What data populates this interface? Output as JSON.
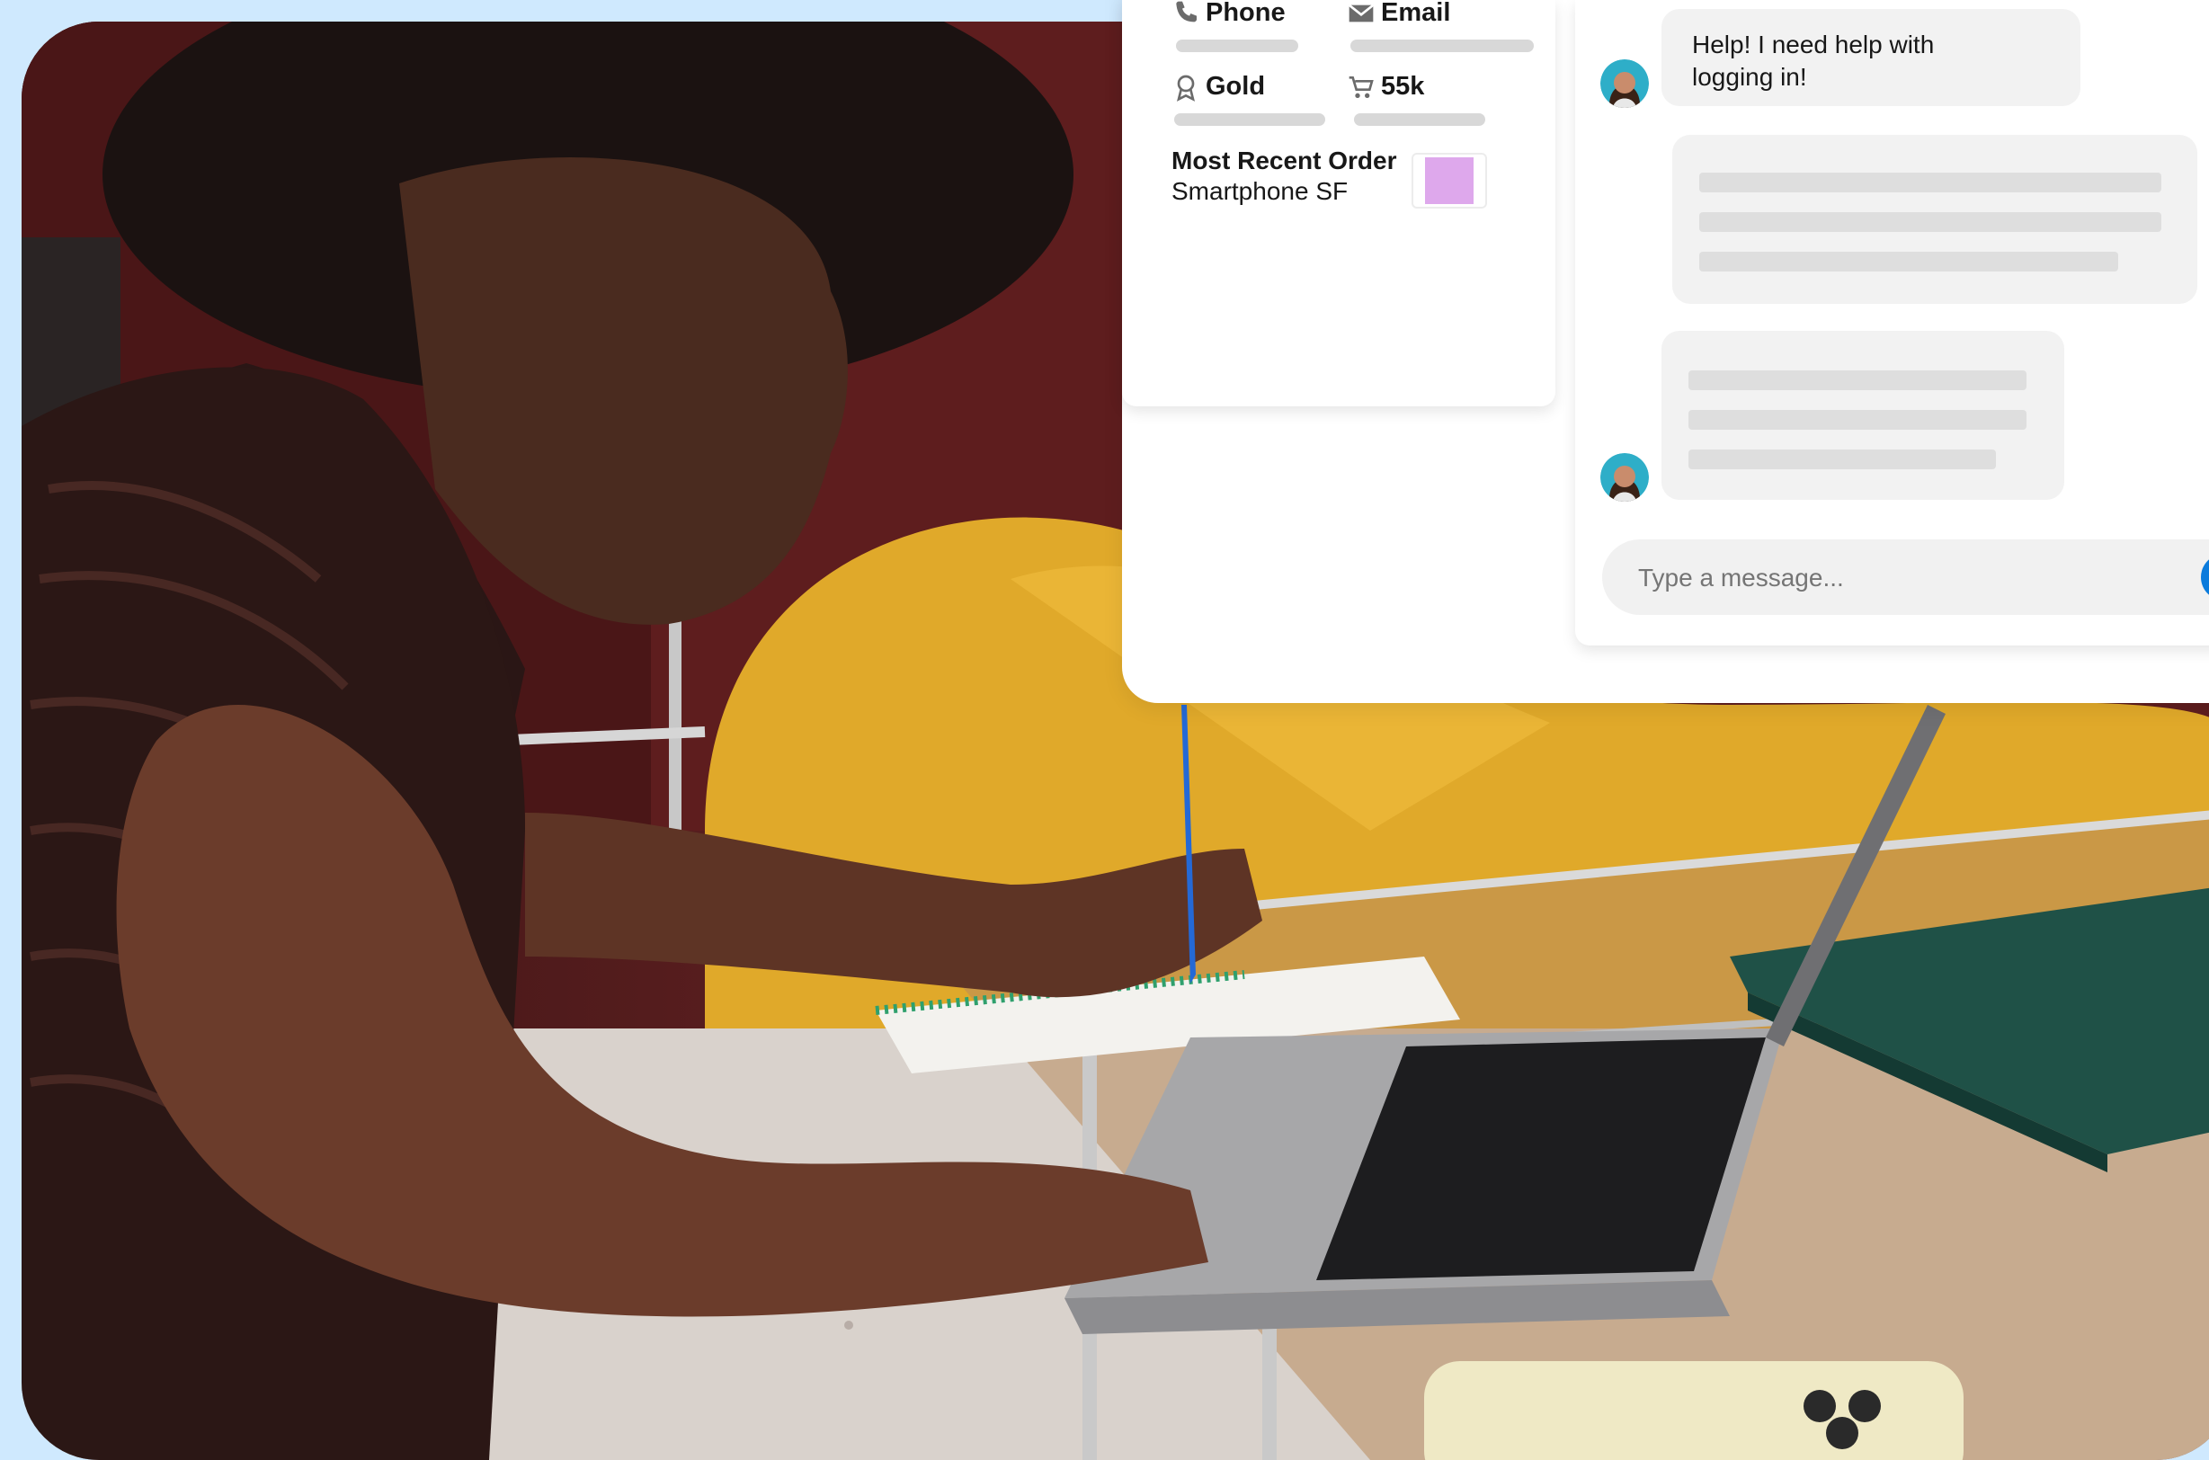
{
  "customer": {
    "phone_label": "Phone",
    "email_label": "Email",
    "tier_label": "Gold",
    "value_label": "55k",
    "recent_order_title": "Most Recent Order",
    "recent_order_item": "Smartphone SF"
  },
  "chat": {
    "customer_message": "Help! I need help with logging in!",
    "composer_placeholder": "Type a message..."
  },
  "icons": {
    "phone": "phone-icon",
    "email": "envelope-icon",
    "tier": "award-ribbon-icon",
    "value": "shopping-cart-icon",
    "send": "send-icon"
  },
  "colors": {
    "background": "#cfe9fe",
    "order_swatch": "#dea8ec",
    "send_button": "#0b7bdc"
  }
}
